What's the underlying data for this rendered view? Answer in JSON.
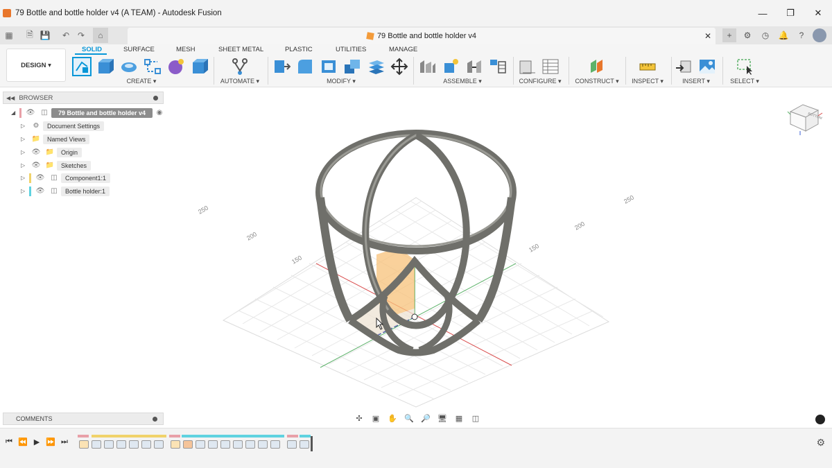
{
  "window": {
    "title": "79 Bottle and bottle holder v4 (A TEAM) - Autodesk Fusion",
    "controls": [
      "minimize-icon",
      "restore-icon",
      "close-icon"
    ]
  },
  "tabbar": {
    "doc_title": "79 Bottle and bottle holder v4"
  },
  "ribbon": {
    "workspace": "DESIGN ▾",
    "tabs": [
      "SOLID",
      "SURFACE",
      "MESH",
      "SHEET METAL",
      "PLASTIC",
      "UTILITIES",
      "MANAGE"
    ],
    "active_tab": "SOLID",
    "groups": [
      "CREATE ▾",
      "AUTOMATE ▾",
      "MODIFY ▾",
      "ASSEMBLE ▾",
      "CONFIGURE ▾",
      "CONSTRUCT ▾",
      "INSPECT ▾",
      "INSERT ▾",
      "SELECT ▾"
    ]
  },
  "browser": {
    "title": "BROWSER",
    "root": "79 Bottle and bottle holder v4",
    "items": [
      {
        "label": "Document Settings",
        "icon": "gear-icon"
      },
      {
        "label": "Named Views",
        "icon": "folder-icon"
      },
      {
        "label": "Origin",
        "icon": "folder-icon"
      },
      {
        "label": "Sketches",
        "icon": "folder-icon"
      },
      {
        "label": "Component1:1",
        "icon": "component-icon"
      },
      {
        "label": "Bottle holder:1",
        "icon": "body-icon"
      }
    ]
  },
  "comments": {
    "title": "COMMENTS"
  },
  "grid_labels": [
    "250",
    "200",
    "150",
    "250",
    "200",
    "150"
  ],
  "viewcube": {
    "face": "BOTTOM"
  },
  "colors": {
    "accent": "#0696d7",
    "holder": "#6f6f6a",
    "selection": "#f3a033"
  }
}
